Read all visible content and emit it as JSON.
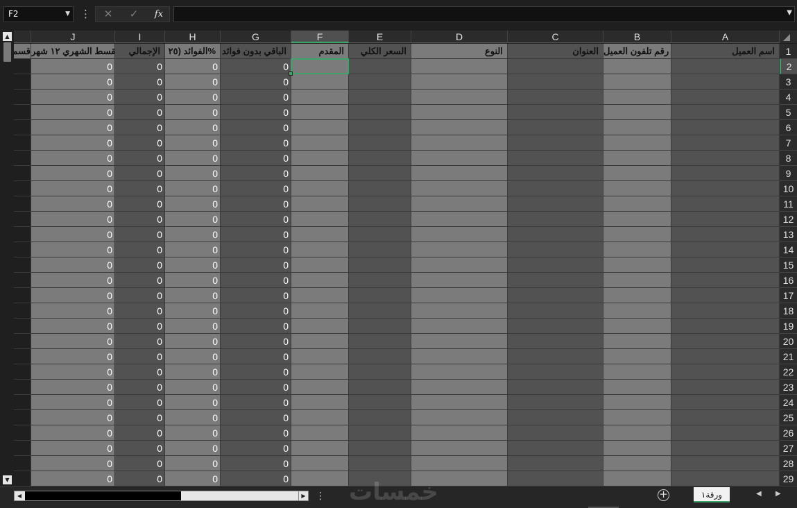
{
  "formula_bar": {
    "name_box": "F2",
    "more_icon": "⋮",
    "cancel_icon": "✕",
    "enter_icon": "✓",
    "fx_label": "fx",
    "formula": ""
  },
  "columns": [
    {
      "letter": "A",
      "header": "اسم العميل"
    },
    {
      "letter": "B",
      "header": "رقم تلفون العميل"
    },
    {
      "letter": "C",
      "header": "العنوان"
    },
    {
      "letter": "D",
      "header": "النوع"
    },
    {
      "letter": "E",
      "header": "السعر الكلي"
    },
    {
      "letter": "F",
      "header": "المقدم"
    },
    {
      "letter": "G",
      "header": "الباقي بدون فوائد"
    },
    {
      "letter": "H",
      "header": "الفوائد (٢٥%"
    },
    {
      "letter": "I",
      "header": "الإجمالي"
    },
    {
      "letter": "J",
      "header": "القسط الشهري ١٢ شهر"
    },
    {
      "letter": "",
      "header": "قسم"
    }
  ],
  "rows": [
    "1",
    "2",
    "3",
    "4",
    "5",
    "6",
    "7",
    "8",
    "9",
    "10",
    "11",
    "12",
    "13",
    "14",
    "15",
    "16",
    "17",
    "18",
    "19",
    "20",
    "21",
    "22",
    "23",
    "24",
    "25",
    "26",
    "27",
    "28",
    "29"
  ],
  "numeric_value": "0",
  "selected_cell": "F2",
  "sheet_tab": "ورقة١",
  "watermark": "خمسات",
  "colors": {
    "accent": "#3fa46b",
    "cell_light": "#7b7b7b",
    "cell_dark": "#525252",
    "background": "#1f1f1f"
  },
  "icons": {
    "add_sheet": "plus-circle-icon",
    "tab_prev": "triangle-left-icon",
    "tab_next": "triangle-right-icon"
  }
}
